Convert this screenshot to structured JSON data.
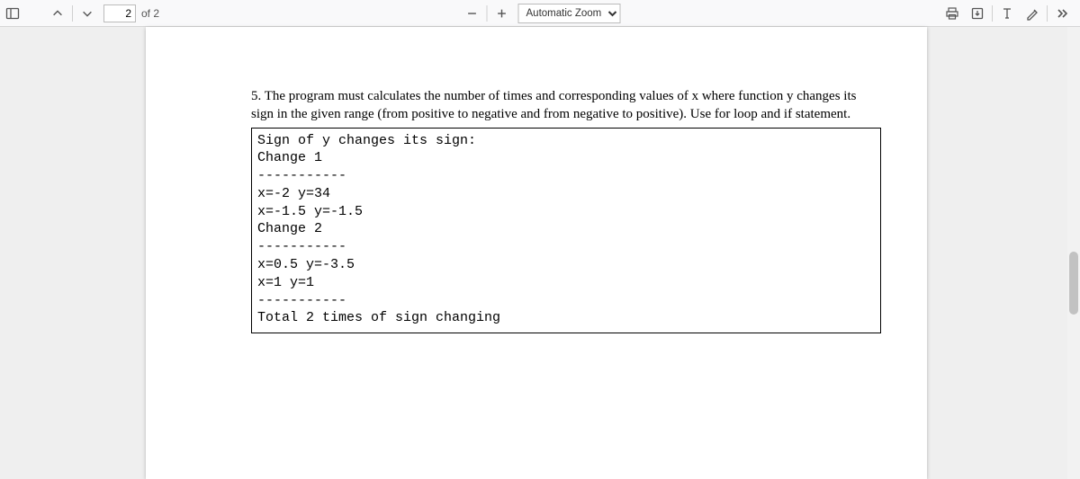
{
  "page": {
    "current": "2",
    "total_label": "of 2"
  },
  "zoom": {
    "selected": "Automatic Zoom"
  },
  "doc": {
    "paragraph": "5. The program must calculates the number of times and corresponding values of x where function y changes its sign in the given range (from positive to negative and from negative to positive). Use for loop and if statement.",
    "output": "Sign of y changes its sign:\nChange 1\n-----------\nx=-2 y=34\nx=-1.5 y=-1.5\nChange 2\n-----------\nx=0.5 y=-3.5\nx=1 y=1\n-----------\nTotal 2 times of sign changing"
  }
}
